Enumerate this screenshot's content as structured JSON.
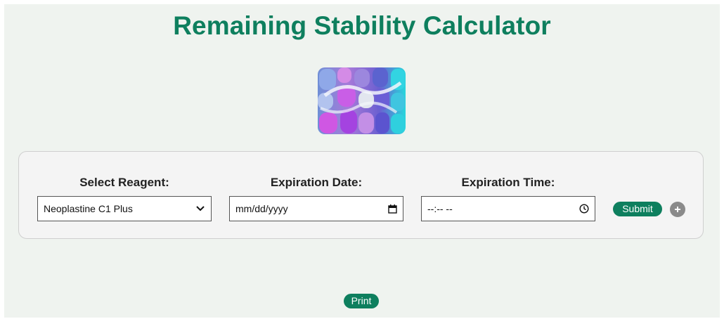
{
  "header": {
    "title": "Remaining Stability Calculator"
  },
  "form": {
    "reagent": {
      "label": "Select Reagent:",
      "selected": "Neoplastine C1 Plus"
    },
    "expiration_date": {
      "label": "Expiration Date:",
      "value": "mm/dd/yyyy"
    },
    "expiration_time": {
      "label": "Expiration Time:",
      "value": "--:-- --"
    },
    "submit_label": "Submit"
  },
  "footer": {
    "print_label": "Print"
  },
  "colors": {
    "accent": "#0e7f5e",
    "page_background": "#eff3ef",
    "card_background": "#f4f4f4",
    "add_button": "#8a8a8a"
  },
  "icons": {
    "reagent_dropdown": "chevron-down-icon",
    "date_picker": "calendar-icon",
    "time_picker": "clock-icon",
    "add": "plus-icon"
  }
}
